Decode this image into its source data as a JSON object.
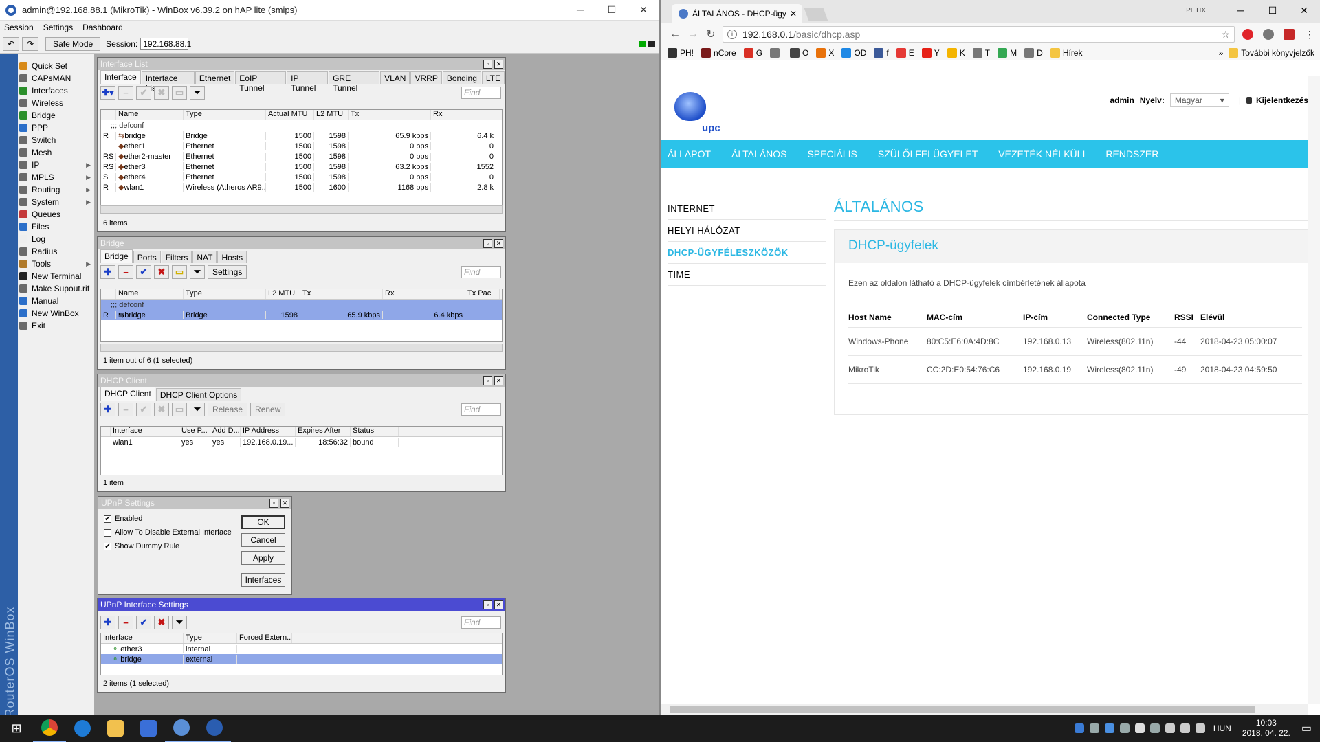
{
  "winbox": {
    "title": "admin@192.168.88.1 (MikroTik) - WinBox v6.39.2 on hAP lite (smips)",
    "menu": [
      "Session",
      "Settings",
      "Dashboard"
    ],
    "safe_mode": "Safe Mode",
    "session_label": "Session:",
    "session_value": "192.168.88.1",
    "brand_vertical": "RouterOS WinBox",
    "sidebar": [
      {
        "label": "Quick Set",
        "icon": "quick-set-icon",
        "color": "#d88a18",
        "arrow": ""
      },
      {
        "label": "CAPsMAN",
        "icon": "capsman-icon",
        "color": "#6a6a6a",
        "arrow": ""
      },
      {
        "label": "Interfaces",
        "icon": "interfaces-icon",
        "color": "#2b8f2b",
        "arrow": ""
      },
      {
        "label": "Wireless",
        "icon": "wireless-icon",
        "color": "#6a6a6a",
        "arrow": ""
      },
      {
        "label": "Bridge",
        "icon": "bridge-icon",
        "color": "#2b8f2b",
        "arrow": ""
      },
      {
        "label": "PPP",
        "icon": "ppp-icon",
        "color": "#2b6fc9",
        "arrow": ""
      },
      {
        "label": "Switch",
        "icon": "switch-icon",
        "color": "#6a6a6a",
        "arrow": ""
      },
      {
        "label": "Mesh",
        "icon": "mesh-icon",
        "color": "#6a6a6a",
        "arrow": ""
      },
      {
        "label": "IP",
        "icon": "ip-icon",
        "color": "#6a6a6a",
        "arrow": "▶"
      },
      {
        "label": "MPLS",
        "icon": "mpls-icon",
        "color": "#6a6a6a",
        "arrow": "▶"
      },
      {
        "label": "Routing",
        "icon": "routing-icon",
        "color": "#6a6a6a",
        "arrow": "▶"
      },
      {
        "label": "System",
        "icon": "system-icon",
        "color": "#6a6a6a",
        "arrow": "▶"
      },
      {
        "label": "Queues",
        "icon": "queues-icon",
        "color": "#c4393a",
        "arrow": ""
      },
      {
        "label": "Files",
        "icon": "files-icon",
        "color": "#2b6fc9",
        "arrow": ""
      },
      {
        "label": "Log",
        "icon": "log-icon",
        "color": "#eeeeee",
        "arrow": ""
      },
      {
        "label": "Radius",
        "icon": "radius-icon",
        "color": "#6a6a6a",
        "arrow": ""
      },
      {
        "label": "Tools",
        "icon": "tools-icon",
        "color": "#b07a2a",
        "arrow": "▶"
      },
      {
        "label": "New Terminal",
        "icon": "terminal-icon",
        "color": "#222222",
        "arrow": ""
      },
      {
        "label": "Make Supout.rif",
        "icon": "supout-icon",
        "color": "#6a6a6a",
        "arrow": ""
      },
      {
        "label": "Manual",
        "icon": "manual-icon",
        "color": "#2b6fc9",
        "arrow": ""
      },
      {
        "label": "New WinBox",
        "icon": "winbox-icon",
        "color": "#2b6fc9",
        "arrow": ""
      },
      {
        "label": "Exit",
        "icon": "exit-icon",
        "color": "#6a6a6a",
        "arrow": ""
      }
    ],
    "interface_list": {
      "title": "Interface List",
      "tabs": [
        "Interface",
        "Interface List",
        "Ethernet",
        "EoIP Tunnel",
        "IP Tunnel",
        "GRE Tunnel",
        "VLAN",
        "VRRP",
        "Bonding",
        "LTE"
      ],
      "find": "Find",
      "columns": [
        "",
        "Name",
        "Type",
        "Actual MTU",
        "L2 MTU",
        "Tx",
        "Rx"
      ],
      "group": ";;; defconf",
      "rows": [
        {
          "flag": "R",
          "name": "bridge",
          "type": "Bridge",
          "mtu": "1500",
          "l2mtu": "1598",
          "tx": "65.9 kbps",
          "rx": "6.4 k"
        },
        {
          "flag": "",
          "name": "ether1",
          "type": "Ethernet",
          "mtu": "1500",
          "l2mtu": "1598",
          "tx": "0 bps",
          "rx": "0"
        },
        {
          "flag": "RS",
          "name": "ether2-master",
          "type": "Ethernet",
          "mtu": "1500",
          "l2mtu": "1598",
          "tx": "0 bps",
          "rx": "0"
        },
        {
          "flag": "RS",
          "name": "ether3",
          "type": "Ethernet",
          "mtu": "1500",
          "l2mtu": "1598",
          "tx": "63.2 kbps",
          "rx": "1552"
        },
        {
          "flag": "S",
          "name": "ether4",
          "type": "Ethernet",
          "mtu": "1500",
          "l2mtu": "1598",
          "tx": "0 bps",
          "rx": "0"
        },
        {
          "flag": "R",
          "name": "wlan1",
          "type": "Wireless (Atheros AR9...",
          "mtu": "1500",
          "l2mtu": "1600",
          "tx": "1168 bps",
          "rx": "2.8 k"
        }
      ],
      "status": "6 items"
    },
    "bridge": {
      "title": "Bridge",
      "tabs": [
        "Bridge",
        "Ports",
        "Filters",
        "NAT",
        "Hosts"
      ],
      "settings_btn": "Settings",
      "find": "Find",
      "columns": [
        "",
        "Name",
        "Type",
        "L2 MTU",
        "Tx",
        "Rx",
        "Tx Pac"
      ],
      "group": ";;; defconf",
      "rows": [
        {
          "flag": "R",
          "name": "bridge",
          "type": "Bridge",
          "l2mtu": "1598",
          "tx": "65.9 kbps",
          "rx": "6.4 kbps"
        }
      ],
      "status": "1 item out of 6 (1 selected)"
    },
    "dhcp_client": {
      "title": "DHCP Client",
      "tabs": [
        "DHCP Client",
        "DHCP Client Options"
      ],
      "release": "Release",
      "renew": "Renew",
      "find": "Find",
      "columns": [
        "Interface",
        "Use P...",
        "Add D...",
        "IP Address",
        "Expires After",
        "Status"
      ],
      "rows": [
        {
          "iface": "wlan1",
          "usep": "yes",
          "addd": "yes",
          "ip": "192.168.0.19...",
          "expires": "18:56:32",
          "status": "bound"
        }
      ],
      "status": "1 item"
    },
    "upnp_settings": {
      "title": "UPnP Settings",
      "enabled": "Enabled",
      "allow_disable": "Allow To Disable External Interface",
      "show_dummy": "Show Dummy Rule",
      "ok": "OK",
      "cancel": "Cancel",
      "apply": "Apply",
      "interfaces": "Interfaces"
    },
    "upnp_interface": {
      "title": "UPnP Interface Settings",
      "find": "Find",
      "columns": [
        "Interface",
        "Type",
        "Forced Extern..."
      ],
      "rows": [
        {
          "iface": "ether3",
          "type": "internal"
        },
        {
          "iface": "bridge",
          "type": "external"
        }
      ],
      "status": "2 items (1 selected)"
    }
  },
  "chrome": {
    "tab_title": "ÁLTALÁNOS - DHCP-ügy",
    "profile": "PETIX",
    "url_host": "192.168.0.1",
    "url_path": "/basic/dhcp.asp",
    "bookmarks": [
      {
        "label": "PH!",
        "color": "#333333"
      },
      {
        "label": "nCore",
        "color": "#7a1a1a"
      },
      {
        "label": "G",
        "color": "#d93025"
      },
      {
        "label": "",
        "color": "#777777"
      },
      {
        "label": "O",
        "color": "#444444"
      },
      {
        "label": "X",
        "color": "#e8710a"
      },
      {
        "label": "OD",
        "color": "#1e88e5"
      },
      {
        "label": "f",
        "color": "#3b5998"
      },
      {
        "label": "E",
        "color": "#e53935"
      },
      {
        "label": "Y",
        "color": "#e62117"
      },
      {
        "label": "K",
        "color": "#f4b400"
      },
      {
        "label": "T",
        "color": "#777777"
      },
      {
        "label": "M",
        "color": "#34a853"
      },
      {
        "label": "D",
        "color": "#777777"
      },
      {
        "label": "Hírek",
        "color": "#f4c542"
      }
    ],
    "more_bookmarks": "További könyvjelzők"
  },
  "router_page": {
    "brand": "upc",
    "user": "admin",
    "lang_label": "Nyelv:",
    "lang_value": "Magyar",
    "logout": "Kijelentkezés",
    "nav": [
      "ÁLLAPOT",
      "ÁLTALÁNOS",
      "SPECIÁLIS",
      "SZÜLŐI FELÜGYELET",
      "VEZETÉK NÉLKÜLI",
      "RENDSZER"
    ],
    "side": [
      "INTERNET",
      "HELYI HÁLÓZAT",
      "DHCP-ÜGYFÉLESZKÖZÖK",
      "TIME"
    ],
    "page_title": "ÁLTALÁNOS",
    "card_title": "DHCP-ügyfelek",
    "card_desc": "Ezen az oldalon látható a DHCP-ügyfelek címbérletének állapota",
    "columns": [
      "Host Name",
      "MAC-cím",
      "IP-cím",
      "Connected Type",
      "RSSI",
      "Elévül"
    ],
    "rows": [
      {
        "host": "Windows-Phone",
        "mac": "80:C5:E6:0A:4D:8C",
        "ip": "192.168.0.13",
        "type": "Wireless(802.11n)",
        "rssi": "-44",
        "expire": "2018-04-23 05:00:07"
      },
      {
        "host": "MikroTik",
        "mac": "CC:2D:E0:54:76:C6",
        "ip": "192.168.0.19",
        "type": "Wireless(802.11n)",
        "rssi": "-49",
        "expire": "2018-04-23 04:59:50"
      }
    ]
  },
  "taskbar": {
    "lang": "HUN",
    "time": "10:03",
    "date": "2018. 04. 22."
  }
}
